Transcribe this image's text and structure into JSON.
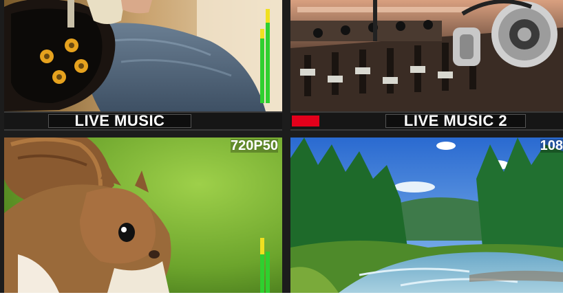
{
  "multiview": {
    "tiles": [
      {
        "position": "top-left",
        "subject": "guitarist",
        "label": "LIVE MUSIC",
        "audio_level_left": 0.75,
        "audio_level_right": 0.95
      },
      {
        "position": "top-right",
        "subject": "dj-mixer",
        "label": "LIVE MUSIC 2",
        "tally": "red"
      },
      {
        "position": "bottom-left",
        "subject": "squirrel",
        "format": "720P50",
        "audio_level_left": 0.6,
        "audio_level_right": 0.5
      },
      {
        "position": "bottom-right",
        "subject": "forest-river",
        "format": "108"
      }
    ]
  },
  "colors": {
    "tally_red": "#e3001b",
    "meter_green": "#2fd02f",
    "meter_yellow": "#f0e020",
    "label_text": "#ffffff"
  }
}
